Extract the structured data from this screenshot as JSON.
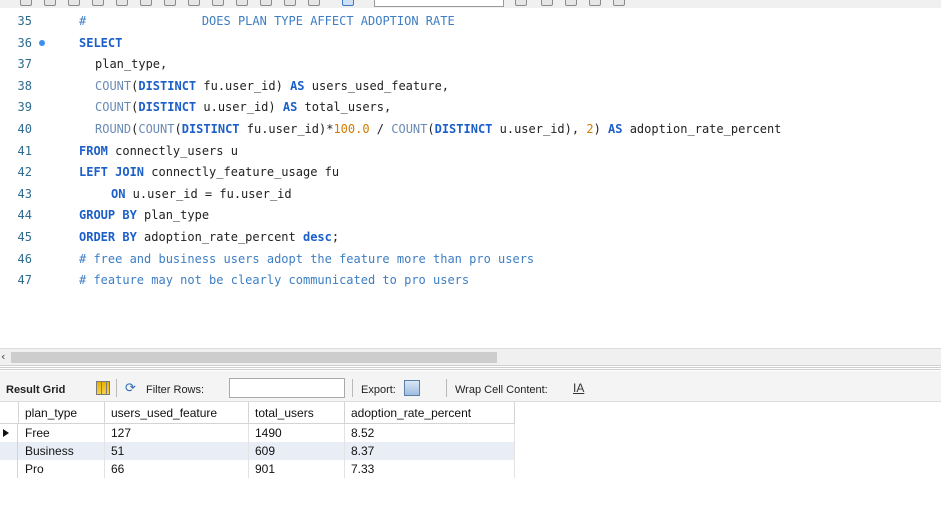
{
  "editor": {
    "lines": [
      {
        "num": "35",
        "indent": 0,
        "tokens": [
          {
            "t": "#",
            "c": "cm"
          },
          {
            "t": "                DOES PLAN TYPE AFFECT ADOPTION RATE",
            "c": "cm"
          }
        ]
      },
      {
        "num": "36",
        "indent": 0,
        "breakpoint": true,
        "tokens": [
          {
            "t": "SELECT",
            "c": "kw"
          }
        ]
      },
      {
        "num": "37",
        "indent": 1,
        "tokens": [
          {
            "t": "plan_type,",
            "c": ""
          }
        ]
      },
      {
        "num": "38",
        "indent": 1,
        "tokens": [
          {
            "t": "COUNT",
            "c": "fn"
          },
          {
            "t": "(",
            "c": ""
          },
          {
            "t": "DISTINCT",
            "c": "kw"
          },
          {
            "t": " fu.user_id) ",
            "c": ""
          },
          {
            "t": "AS",
            "c": "kw"
          },
          {
            "t": " users_used_feature,",
            "c": ""
          }
        ]
      },
      {
        "num": "39",
        "indent": 1,
        "tokens": [
          {
            "t": "COUNT",
            "c": "fn"
          },
          {
            "t": "(",
            "c": ""
          },
          {
            "t": "DISTINCT",
            "c": "kw"
          },
          {
            "t": " u.user_id) ",
            "c": ""
          },
          {
            "t": "AS",
            "c": "kw"
          },
          {
            "t": " total_users,",
            "c": ""
          }
        ]
      },
      {
        "num": "40",
        "indent": 1,
        "tokens": [
          {
            "t": "ROUND",
            "c": "fn"
          },
          {
            "t": "(",
            "c": ""
          },
          {
            "t": "COUNT",
            "c": "fn"
          },
          {
            "t": "(",
            "c": ""
          },
          {
            "t": "DISTINCT",
            "c": "kw"
          },
          {
            "t": " fu.user_id)*",
            "c": ""
          },
          {
            "t": "100.0",
            "c": "num"
          },
          {
            "t": " / ",
            "c": ""
          },
          {
            "t": "COUNT",
            "c": "fn"
          },
          {
            "t": "(",
            "c": ""
          },
          {
            "t": "DISTINCT",
            "c": "kw"
          },
          {
            "t": " u.user_id), ",
            "c": ""
          },
          {
            "t": "2",
            "c": "num"
          },
          {
            "t": ") ",
            "c": ""
          },
          {
            "t": "AS",
            "c": "kw"
          },
          {
            "t": " adoption_rate_percent",
            "c": ""
          }
        ]
      },
      {
        "num": "41",
        "indent": 0,
        "tokens": [
          {
            "t": "FROM",
            "c": "kw"
          },
          {
            "t": " connectly_users u",
            "c": ""
          }
        ]
      },
      {
        "num": "42",
        "indent": 0,
        "tokens": [
          {
            "t": "LEFT JOIN",
            "c": "kw"
          },
          {
            "t": " connectly_feature_usage fu",
            "c": ""
          }
        ]
      },
      {
        "num": "43",
        "indent": 2,
        "tokens": [
          {
            "t": "ON",
            "c": "kw"
          },
          {
            "t": " u.user_id = fu.user_id",
            "c": ""
          }
        ]
      },
      {
        "num": "44",
        "indent": 0,
        "tokens": [
          {
            "t": "GROUP BY",
            "c": "kw"
          },
          {
            "t": " plan_type",
            "c": ""
          }
        ]
      },
      {
        "num": "45",
        "indent": 0,
        "tokens": [
          {
            "t": "ORDER BY",
            "c": "kw"
          },
          {
            "t": " adoption_rate_percent ",
            "c": ""
          },
          {
            "t": "desc",
            "c": "kw"
          },
          {
            "t": ";",
            "c": ""
          }
        ]
      },
      {
        "num": "46",
        "indent": 0,
        "tokens": [
          {
            "t": "# free and business users adopt the feature more than pro users",
            "c": "cm"
          }
        ]
      },
      {
        "num": "47",
        "indent": 0,
        "tokens": [
          {
            "t": "# feature may not be clearly communicated to pro users",
            "c": "cm"
          }
        ]
      }
    ]
  },
  "result_toolbar": {
    "result_grid_label": "Result Grid",
    "filter_label": "Filter Rows:",
    "filter_value": "",
    "export_label": "Export:",
    "wrap_label": "Wrap Cell Content:",
    "wrap_icon": "IA"
  },
  "grid": {
    "columns": [
      "plan_type",
      "users_used_feature",
      "total_users",
      "adoption_rate_percent"
    ],
    "rows": [
      [
        "Free",
        "127",
        "1490",
        "8.52"
      ],
      [
        "Business",
        "51",
        "609",
        "8.37"
      ],
      [
        "Pro",
        "66",
        "901",
        "7.33"
      ]
    ],
    "selected_row": 0
  },
  "colors": {
    "keyword": "#1c5fc9",
    "function": "#6a8bb4",
    "number": "#d27b00",
    "comment": "#3d7ec4",
    "line_number": "#2e6b8e",
    "alt_row": "#e9eef6"
  },
  "icons": {
    "result_grid": "grid-icon",
    "filter": "filter-icon",
    "export": "export-icon",
    "wrap": "wrap-cell-icon",
    "breakpoint": "breakpoint-dot-icon",
    "row_pointer": "row-pointer-icon"
  }
}
